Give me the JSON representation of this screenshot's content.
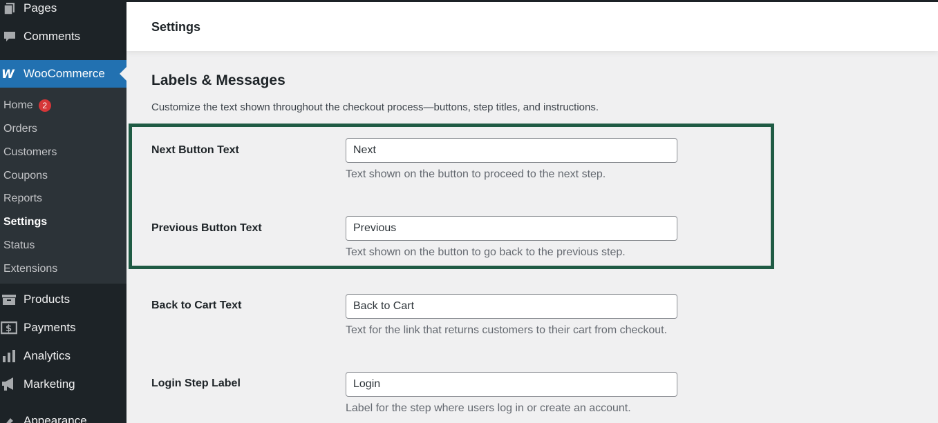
{
  "sidebar": {
    "top_items": [
      {
        "label": "Pages",
        "icon": "pages-icon"
      },
      {
        "label": "Comments",
        "icon": "comments-icon"
      },
      {
        "label": "WooCommerce",
        "icon": "woocommerce-icon"
      },
      {
        "label": "Products",
        "icon": "products-icon"
      },
      {
        "label": "Payments",
        "icon": "payments-icon"
      },
      {
        "label": "Analytics",
        "icon": "analytics-icon"
      },
      {
        "label": "Marketing",
        "icon": "marketing-icon"
      },
      {
        "label": "Appearance",
        "icon": "appearance-icon"
      }
    ],
    "submenu": [
      {
        "label": "Home",
        "badge": "2"
      },
      {
        "label": "Orders"
      },
      {
        "label": "Customers"
      },
      {
        "label": "Coupons"
      },
      {
        "label": "Reports"
      },
      {
        "label": "Settings",
        "active": true
      },
      {
        "label": "Status"
      },
      {
        "label": "Extensions"
      }
    ]
  },
  "header": {
    "title": "Settings"
  },
  "section": {
    "title": "Labels & Messages",
    "description": "Customize the text shown throughout the checkout process—buttons, step titles, and instructions."
  },
  "fields": [
    {
      "label": "Next Button Text",
      "value": "Next",
      "help": "Text shown on the button to proceed to the next step."
    },
    {
      "label": "Previous Button Text",
      "value": "Previous",
      "help": "Text shown on the button to go back to the previous step."
    },
    {
      "label": "Back to Cart Text",
      "value": "Back to Cart",
      "help": "Text for the link that returns customers to their cart from checkout."
    },
    {
      "label": "Login Step Label",
      "value": "Login",
      "help": "Label for the step where users log in or create an account."
    }
  ],
  "colors": {
    "sidebar_bg": "#1d2327",
    "submenu_bg": "#2c3338",
    "accent": "#2271b1",
    "highlight_border": "#1f5b44",
    "badge": "#d63638"
  }
}
